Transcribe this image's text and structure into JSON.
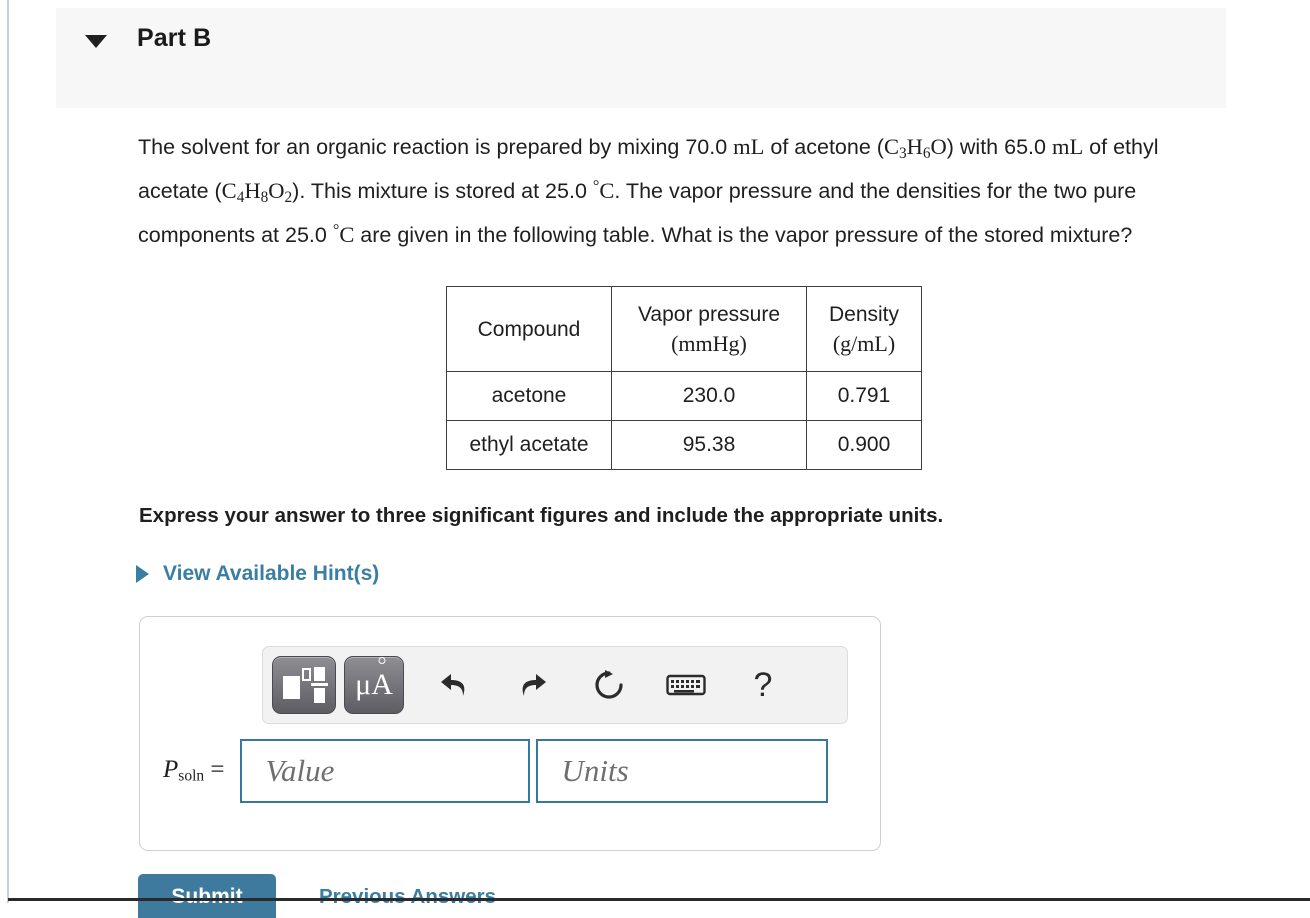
{
  "part_header": {
    "caret_icon": "caret-down-icon",
    "title": "Part B"
  },
  "problem": {
    "line1_a": "The solvent for an organic reaction is prepared by mixing 70.0 ",
    "unit_mL_1": "mL",
    "line1_b": " of acetone (",
    "formula_acetone": "C3H6O",
    "line1_c": ") with",
    "line2_a": "65.0 ",
    "unit_mL_2": "mL",
    "line2_b": " of ethyl acetate (",
    "formula_ethyl_acetate": "C4H8O2",
    "line2_c": "). This mixture is stored at 25.0 ",
    "temp_1": "°C",
    "line2_d": ". The vapor pressure",
    "line3_a": "and the densities for the two pure components at 25.0 ",
    "temp_2": "°C",
    "line3_b": " are given in the following table.",
    "line4": "What is the vapor pressure of the stored mixture?"
  },
  "table": {
    "headers": {
      "compound": "Compound",
      "vapor_pressure_label": "Vapor pressure",
      "vapor_pressure_unit": "(mmHg)",
      "density_label": "Density",
      "density_unit": "(g/mL)"
    },
    "rows": [
      {
        "compound": "acetone",
        "vapor_pressure": "230.0",
        "density": "0.791"
      },
      {
        "compound": "ethyl acetate",
        "vapor_pressure": "95.38",
        "density": "0.900"
      }
    ]
  },
  "instruction": "Express your answer to three significant figures and include the appropriate units.",
  "hints": {
    "triangle_icon": "triangle-right-icon",
    "label": "View Available Hint(s)"
  },
  "toolbar": {
    "template_button": "math-template-icon",
    "units_button": "μÅ",
    "undo_icon": "undo-arrow-icon",
    "redo_icon": "redo-arrow-icon",
    "reset_icon": "reset-circular-arrow-icon",
    "keyboard_icon": "keyboard-icon",
    "help_icon": "?"
  },
  "answer": {
    "variable_symbol": "P",
    "variable_subscript": "soln",
    "equals": "=",
    "value_placeholder": "Value",
    "units_placeholder": "Units"
  },
  "footer": {
    "submit_label": "Submit",
    "previous_answers_label": "Previous Answers"
  },
  "colors": {
    "accent_blue": "#3a7ea3",
    "submit_blue": "#3d7a9e",
    "input_border": "#357a9e",
    "header_band": "#f7f7f7",
    "left_rail": "#c3d2dc"
  }
}
